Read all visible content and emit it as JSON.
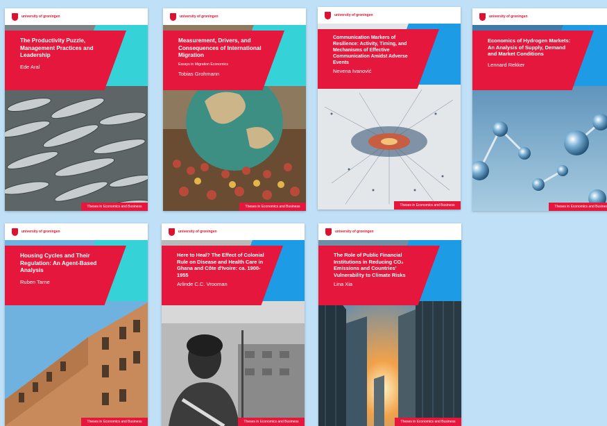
{
  "publisher_logo_text": "university of groningen",
  "books": [
    {
      "title": "The Productivity Puzzle, Management Practices and Leadership",
      "subtitle": "",
      "author": "Ede Aral",
      "series": "Theses in Economics and Business",
      "accent": "#35d3d8",
      "art": "fish-school"
    },
    {
      "title": "Measurement, Drivers, and Consequences of International Migration",
      "subtitle": "Essays in Migration Economics",
      "author": "Tobias Grohmann",
      "series": "Theses in Economics and Business",
      "accent": "#35d3d8",
      "art": "crowd-globe"
    },
    {
      "title": "Communication Markers of Resilience: Activity, Timing, and Mechanisms of Effective Communication Amidst Adverse Events",
      "subtitle": "",
      "author": "Nevena Ivanović",
      "series": "Theses in Economics and Business",
      "accent": "#1e9be5",
      "art": "network-burst"
    },
    {
      "title": "Economics of Hydrogen Markets: An Analysis of Supply, Demand and Market Conditions",
      "subtitle": "",
      "author": "Lennard Rekker",
      "series": "Theses in Economics and Business",
      "accent": "#1e9be5",
      "art": "molecules"
    },
    {
      "title": "Housing Cycles and Their Regulation: An Agent-Based Analysis",
      "subtitle": "",
      "author": "Ruben Tarne",
      "series": "Theses in Economics and Business",
      "accent": "#35d3d8",
      "art": "buildings"
    },
    {
      "title": "Here to Heal? The Effect of Colonial Rule on Disease and Health Care in Ghana and Côte d'Ivoire: ca. 1900-1955",
      "subtitle": "",
      "author": "Arlinde C.C. Vrooman",
      "series": "Theses in Economics and Business",
      "accent": "#1e9be5",
      "art": "historic-photo"
    },
    {
      "title": "The Role of Public Financial Institutions in Reducing CO₂ Emissions and Countries' Vulnerability to Climate Risks",
      "subtitle": "",
      "author": "Lina Xia",
      "series": "Theses in Economics and Business",
      "accent": "#1e9be5",
      "art": "skyscrapers"
    }
  ]
}
